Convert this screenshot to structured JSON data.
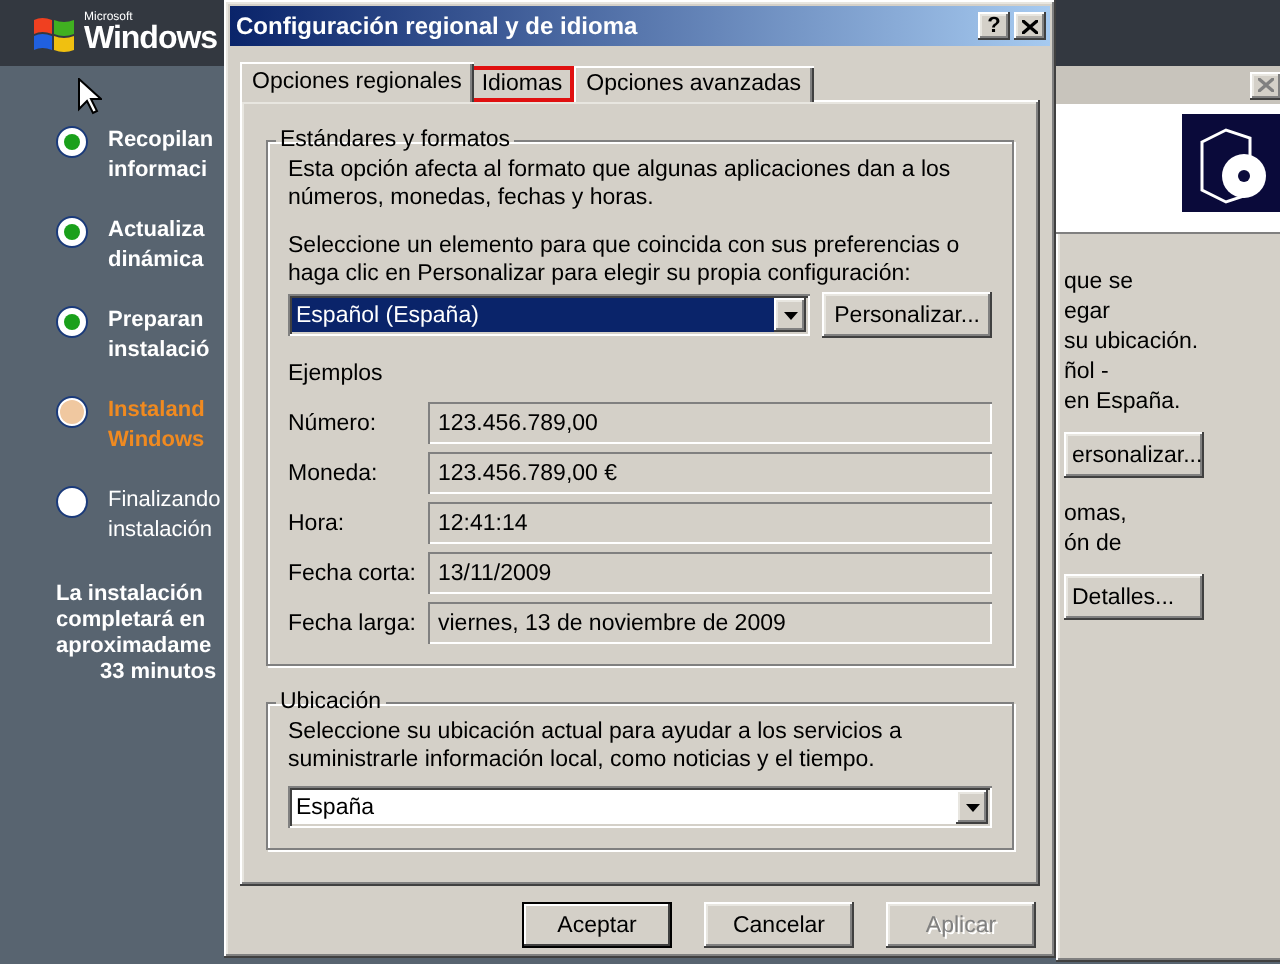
{
  "setup": {
    "logo": {
      "brand": "Microsoft",
      "product": "Windows"
    },
    "steps": [
      {
        "lines": [
          "Recopilan",
          "informaci"
        ],
        "kind": "done"
      },
      {
        "lines": [
          "Actualiza",
          "dinámica"
        ],
        "kind": "done"
      },
      {
        "lines": [
          "Preparan",
          "instalació"
        ],
        "kind": "done"
      },
      {
        "lines": [
          "Instaland",
          "Windows"
        ],
        "kind": "current"
      },
      {
        "lines": [
          "Finalizando",
          "instalación"
        ],
        "kind": "pending"
      }
    ],
    "remaining": [
      "La instalación",
      "completará en",
      "aproximadame",
      "33 minutos"
    ]
  },
  "background_window": {
    "lines": [
      {
        "text": "que se",
        "kind": "text"
      },
      {
        "text": "egar",
        "kind": "text"
      },
      {
        "text": "su ubicación.",
        "kind": "text"
      },
      {
        "text": "ñol -",
        "kind": "text"
      },
      {
        "text": "en España.",
        "kind": "text"
      },
      {
        "text": "ersonalizar...",
        "kind": "button"
      },
      {
        "text": "omas,",
        "kind": "text"
      },
      {
        "text": "ón de",
        "kind": "text"
      },
      {
        "text": "Detalles...",
        "kind": "button"
      }
    ]
  },
  "dialog": {
    "title": "Configuración regional y de idioma",
    "help_button": "?",
    "tabs": [
      {
        "label": "Opciones regionales",
        "selected": true,
        "highlighted": false
      },
      {
        "label": "Idiomas",
        "selected": false,
        "highlighted": true
      },
      {
        "label": "Opciones avanzadas",
        "selected": false,
        "highlighted": false
      }
    ],
    "standards": {
      "title": "Estándares y formatos",
      "description": "Esta opción afecta al formato que algunas aplicaciones dan a los números, monedas, fechas y horas.",
      "prompt": "Seleccione un elemento para que coincida con sus preferencias o haga clic en Personalizar para elegir su propia configuración:",
      "select": "Español (España)",
      "customize_button": "Personalizar...",
      "examples_title": "Ejemplos",
      "examples": [
        {
          "label": "Número:",
          "value": "123.456.789,00"
        },
        {
          "label": "Moneda:",
          "value": "123.456.789,00 €"
        },
        {
          "label": "Hora:",
          "value": "12:41:14"
        },
        {
          "label": "Fecha corta:",
          "value": "13/11/2009"
        },
        {
          "label": "Fecha larga:",
          "value": "viernes, 13 de noviembre de 2009"
        }
      ]
    },
    "location": {
      "title": "Ubicación",
      "description": "Seleccione su ubicación actual para ayudar a los servicios a suministrarle información local, como noticias y el tiempo.",
      "select": "España"
    },
    "buttons": [
      {
        "label": "Aceptar",
        "default": true,
        "disabled": false
      },
      {
        "label": "Cancelar",
        "default": false,
        "disabled": false
      },
      {
        "label": "Aplicar",
        "default": false,
        "disabled": true
      }
    ]
  }
}
